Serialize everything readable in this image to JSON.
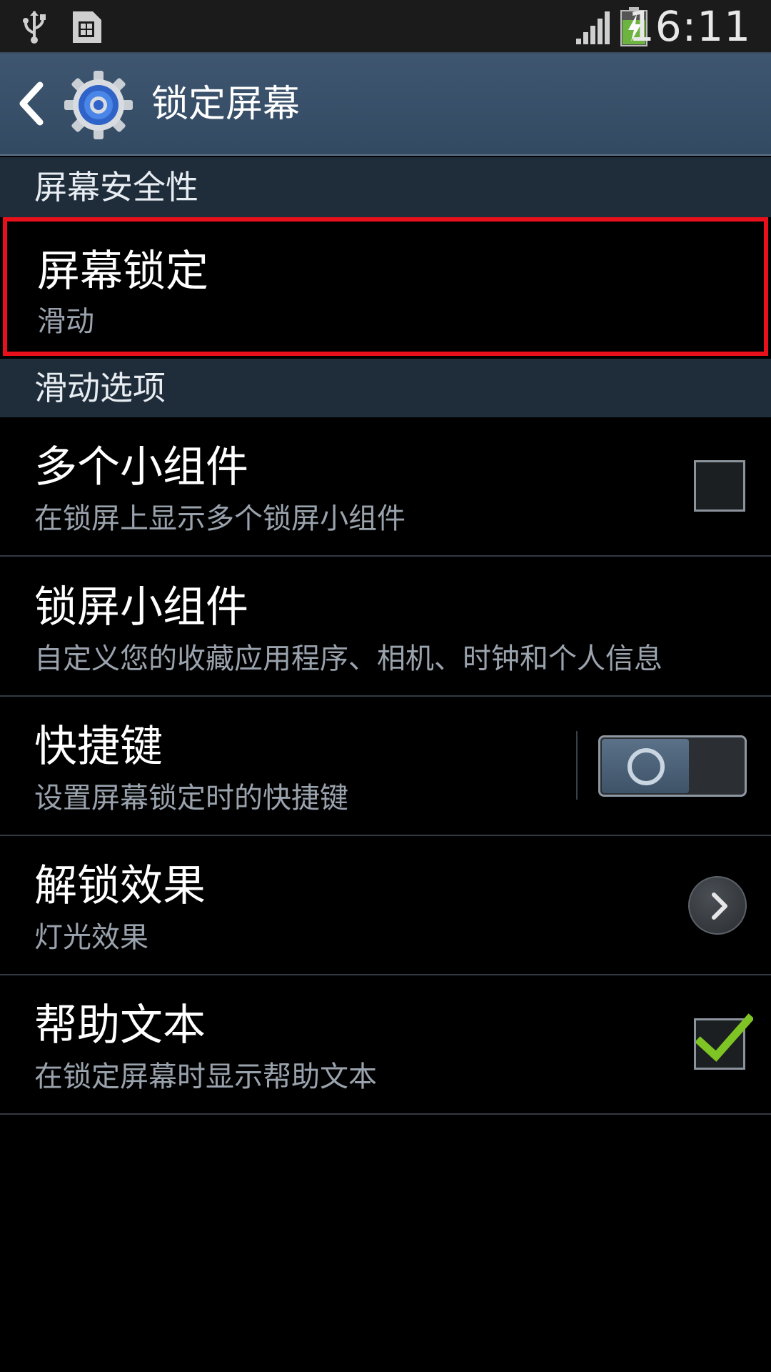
{
  "status_bar": {
    "time": "16:11",
    "icons": [
      "usb-icon",
      "sim-card-icon",
      "signal-icon",
      "battery-charging-icon"
    ]
  },
  "action_bar": {
    "title": "锁定屏幕",
    "icons": [
      "back-arrow-icon",
      "settings-gear-icon"
    ]
  },
  "sections": [
    {
      "header": "屏幕安全性",
      "items": [
        {
          "title": "屏幕锁定",
          "subtitle": "滑动",
          "control": "none",
          "highlighted": true
        }
      ]
    },
    {
      "header": "滑动选项",
      "items": [
        {
          "title": "多个小组件",
          "subtitle": "在锁屏上显示多个锁屏小组件",
          "control": "checkbox",
          "checked": false
        },
        {
          "title": "锁屏小组件",
          "subtitle": "自定义您的收藏应用程序、相机、时钟和个人信息",
          "control": "none"
        },
        {
          "title": "快捷键",
          "subtitle": "设置屏幕锁定时的快捷键",
          "control": "toggle",
          "on": false
        },
        {
          "title": "解锁效果",
          "subtitle": "灯光效果",
          "control": "chevron"
        },
        {
          "title": "帮助文本",
          "subtitle": "在锁定屏幕时显示帮助文本",
          "control": "checkbox",
          "checked": true
        }
      ]
    }
  ],
  "colors": {
    "action_bar": "#3a5069",
    "section_header": "#1f2c3a",
    "highlight_border": "#e8101a",
    "checkmark": "#7dc424",
    "battery_fill": "#6db33f"
  }
}
